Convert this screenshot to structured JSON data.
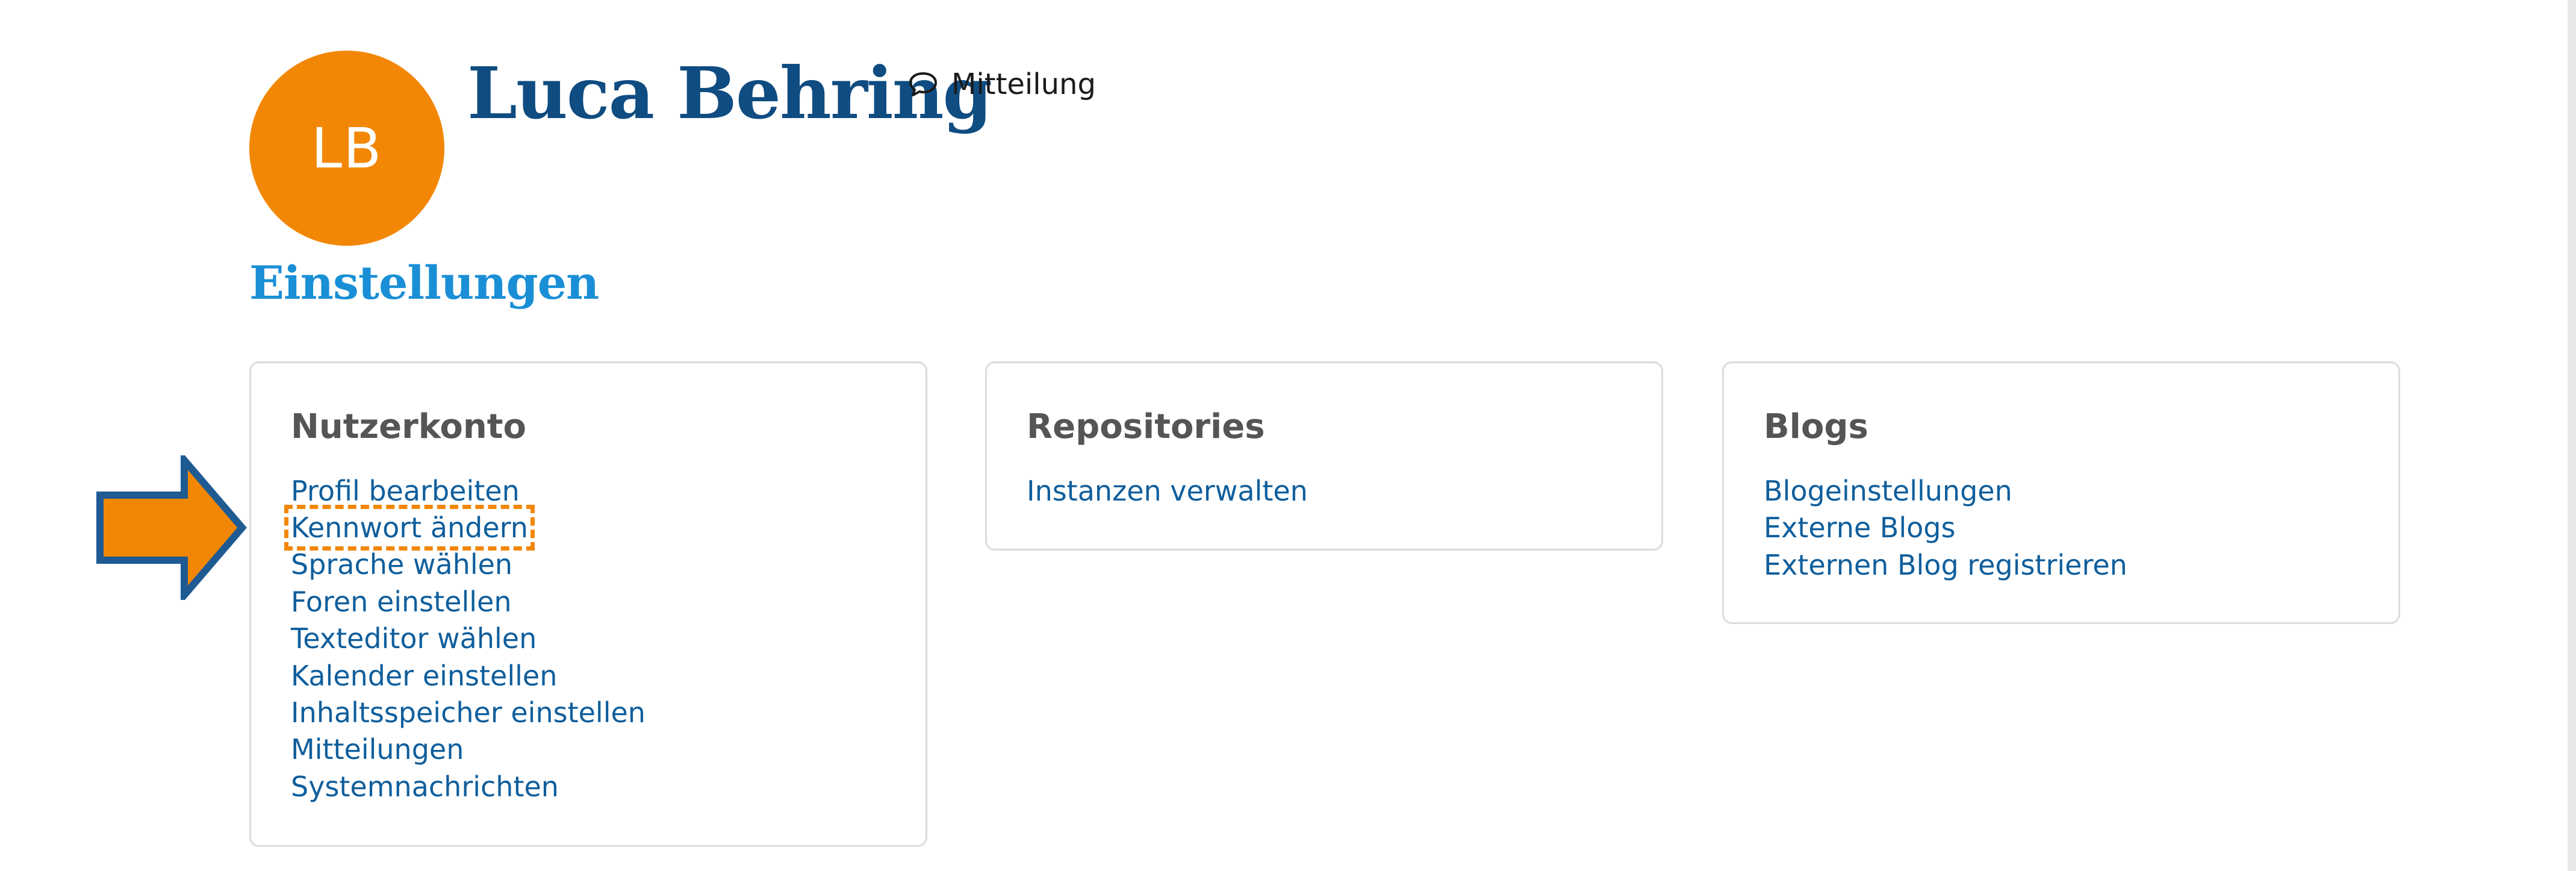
{
  "profile": {
    "avatar_initials": "LB",
    "name": "Luca Behring",
    "message_label": "Mitteilung"
  },
  "page": {
    "section_title": "Einstellungen"
  },
  "cards": {
    "account": {
      "title": "Nutzerkonto",
      "links": [
        "Profil bearbeiten",
        "Kennwort ändern",
        "Sprache wählen",
        "Foren einstellen",
        "Texteditor wählen",
        "Kalender einstellen",
        "Inhaltsspeicher einstellen",
        "Mitteilungen",
        "Systemnachrichten"
      ]
    },
    "repositories": {
      "title": "Repositories",
      "links": [
        "Instanzen verwalten"
      ]
    },
    "blogs": {
      "title": "Blogs",
      "links": [
        "Blogeinstellungen",
        "Externe Blogs",
        "Externen Blog registrieren"
      ]
    }
  },
  "colors": {
    "avatar": "#f28705",
    "name": "#0f4c81",
    "section_title": "#1a8fd6",
    "link": "#0f5e9c",
    "highlight": "#f28705"
  },
  "annotation": {
    "icon": "right-arrow-icon",
    "target": "Kennwort ändern"
  }
}
